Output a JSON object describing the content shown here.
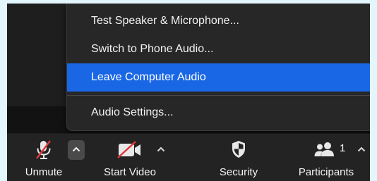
{
  "audio_menu": {
    "items": [
      {
        "label": "Test Speaker & Microphone...",
        "selected": false
      },
      {
        "label": "Switch to Phone Audio...",
        "selected": false
      },
      {
        "label": "Leave Computer Audio",
        "selected": true
      },
      {
        "label": "Audio Settings...",
        "selected": false
      }
    ]
  },
  "toolbar": {
    "unmute": {
      "label": "Unmute",
      "icon": "microphone-muted-icon"
    },
    "start_video": {
      "label": "Start Video",
      "icon": "video-camera-off-icon"
    },
    "security": {
      "label": "Security",
      "icon": "shield-icon"
    },
    "participants": {
      "label": "Participants",
      "icon": "participants-icon",
      "count": "1"
    }
  },
  "colors": {
    "accent": "#1a67e6",
    "muted_red": "#e0373a",
    "menu_bg": "#272727",
    "toolbar_bg": "#232323"
  }
}
